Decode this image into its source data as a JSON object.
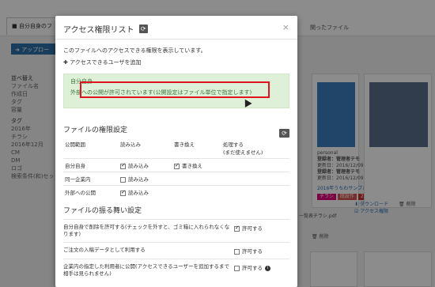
{
  "background": {
    "tab_label": "自分自身のフ",
    "tab_right": "関ったファイル",
    "upload_button": "アップロー",
    "sidebar": [
      {
        "text": "並べ替え",
        "heading": true
      },
      {
        "text": "ファイル名",
        "heading": false
      },
      {
        "text": "作成日",
        "heading": false
      },
      {
        "text": "タグ",
        "heading": false
      },
      {
        "text": "容量",
        "heading": false
      },
      {
        "text": "タグ",
        "heading": true
      },
      {
        "text": "2016年",
        "heading": false
      },
      {
        "text": "チラシ",
        "heading": false
      },
      {
        "text": "2016年12月",
        "heading": false
      },
      {
        "text": "CM",
        "heading": false
      },
      {
        "text": "DM",
        "heading": false
      },
      {
        "text": "ロゴ",
        "heading": false
      },
      {
        "text": "検索条件(和)セット",
        "heading": false
      }
    ],
    "card_text": {
      "owner": "personal",
      "reg1": "登録者：管理者テモ",
      "date1": "更新日：2016/12/09 10:21",
      "reg2": "登録者：管理者テモ",
      "date2": "更新日：2016/12/09 10:21",
      "filename": "2016年うちわサンプル.pdf",
      "chips": [
        "チラシ",
        "既設作",
        "2016年"
      ],
      "download": "ダウンロード",
      "delete": "削除",
      "access": "アクセス権限",
      "mid_file": "一覧表チラシ.pdf",
      "mid_delete": "削除"
    }
  },
  "modal": {
    "title": "アクセス権限リスト",
    "refresh_icon": "refresh-icon",
    "close": "×",
    "description": "このファイルへのアクセスできる権限を表示しています。",
    "add_user": "アクセスできるユーザを追加",
    "alert": {
      "owner": "自分自身",
      "message": "外部への公開が許可されています(公開設定はファイル単位で指定します)"
    },
    "perm_section_title": "ファイルの権限設定",
    "perm_table": {
      "headers": [
        "公開範囲",
        "読み込み",
        "書き換え",
        "処理する\n(まだ使えません)"
      ],
      "rows": [
        {
          "scope": "自分自身",
          "read": "読み込み",
          "read_on": true,
          "write": "書き換え",
          "write_on": true
        },
        {
          "scope": "同一企業内",
          "read": "読み込み",
          "read_on": false,
          "write": "",
          "write_on": false
        },
        {
          "scope": "外部への公開",
          "read": "読み込み",
          "read_on": true,
          "write": "",
          "write_on": false
        }
      ]
    },
    "behavior_section_title": "ファイルの振る舞い設定",
    "behaviors": [
      {
        "label": "自分自身で削除を許可する(チェックを外すと、ゴミ箱に入れられなくなります)",
        "option": "許可する",
        "checked": true,
        "info": false
      },
      {
        "label": "ご注文の入稿データとして利用する",
        "option": "許可する",
        "checked": false,
        "info": false
      },
      {
        "label": "企業内の指定した利用者に公開(アクセスできるユーザーを追加するまで相手は見られません)",
        "option": "許可する",
        "checked": false,
        "info": true
      }
    ]
  }
}
